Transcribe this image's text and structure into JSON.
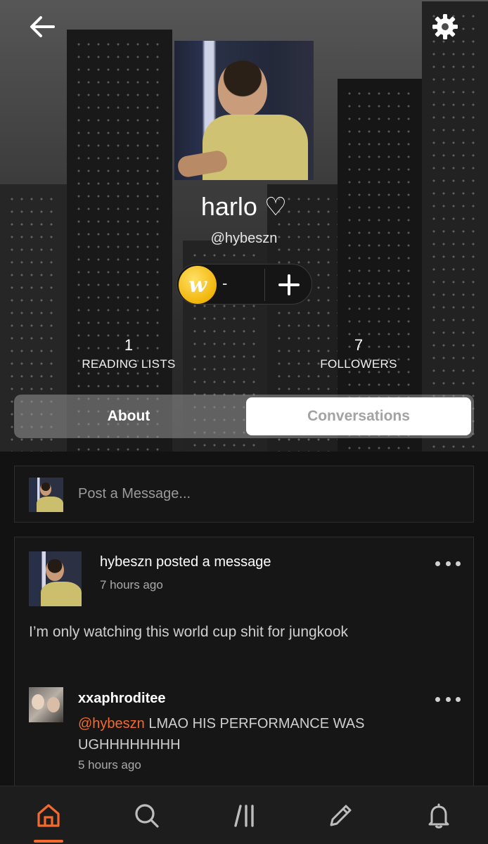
{
  "profile": {
    "display_name": "harlo ♡",
    "handle": "@hybeszn",
    "coins": "-",
    "stats": {
      "reading_lists_count": "1",
      "reading_lists_label": "READING LISTS",
      "followers_count": "7",
      "followers_label": "FOLLOWERS"
    }
  },
  "tabs": {
    "about": "About",
    "conversations": "Conversations"
  },
  "composer": {
    "placeholder": "Post a Message..."
  },
  "message": {
    "title": "hybeszn posted a message",
    "time": "7 hours ago",
    "body": "I’m only watching this world cup shit for jungkook",
    "reply": {
      "user": "xxaphroditee",
      "mention": "@hybeszn",
      "text": " LMAO HIS PERFORMANCE WAS UGHHHHHHHH",
      "time": "5 hours ago"
    }
  },
  "icons": {
    "back": "arrow-left-icon",
    "settings": "gear-icon",
    "coin": "wattpad-coin-icon",
    "coin_letter": "w",
    "plus": "plus-icon",
    "more": "more-dots-icon",
    "home": "home-icon",
    "search": "search-icon",
    "library": "library-icon",
    "write": "pencil-icon",
    "notifications": "bell-icon"
  },
  "colors": {
    "accent": "#f26a2e",
    "background": "#121212",
    "card": "#161616",
    "coin": "#f2b60a"
  }
}
